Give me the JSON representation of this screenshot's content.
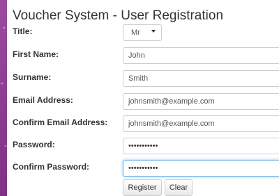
{
  "page": {
    "title": "Voucher System - User Registration"
  },
  "form": {
    "title_label": "Title:",
    "title_value": "Mr",
    "first_name_label": "First Name:",
    "first_name_value": "John",
    "surname_label": "Surname:",
    "surname_value": "Smith",
    "email_label": "Email Address:",
    "email_value": "johnsmith@example.com",
    "confirm_email_label": "Confirm Email Address:",
    "confirm_email_value": "johnsmith@example.com",
    "password_label": "Password:",
    "password_value": "•••••••••••",
    "confirm_password_label": "Confirm Password:",
    "confirm_password_value": "•••••••••••"
  },
  "buttons": {
    "register": "Register",
    "clear": "Clear"
  },
  "colors": {
    "background": "#8a3a8f",
    "focus": "#66afe9"
  }
}
